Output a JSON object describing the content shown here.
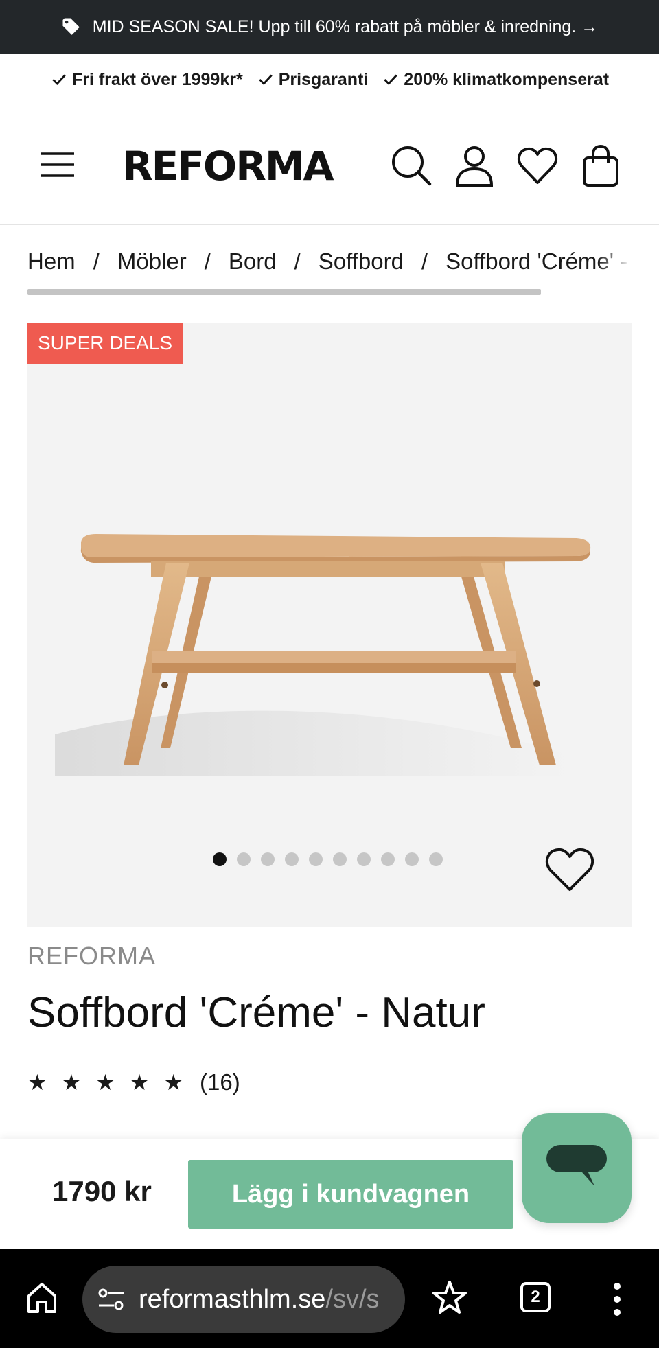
{
  "promo": {
    "text": "MID SEASON SALE! Upp till 60% rabatt på möbler & inredning. →",
    "icon": "tag-icon"
  },
  "usp": [
    {
      "label": "Fri frakt över 1999kr*"
    },
    {
      "label": "Prisgaranti"
    },
    {
      "label": "200% klimatkompenserat"
    }
  ],
  "header": {
    "logo": "REFORMA",
    "icons": [
      "menu-icon",
      "search-icon",
      "account-icon",
      "heart-icon",
      "shopping-bag-icon"
    ]
  },
  "breadcrumb": {
    "items": [
      "Hem",
      "Möbler",
      "Bord",
      "Soffbord",
      "Soffbord 'Créme' - Natur"
    ],
    "separator": "/"
  },
  "gallery": {
    "badge": "SUPER DEALS",
    "image_count": 10,
    "active_index": 0
  },
  "product": {
    "brand": "REFORMA",
    "title": "Soffbord 'Créme' - Natur",
    "stars": "★ ★ ★ ★ ★",
    "rating": 5,
    "review_count": "(16)"
  },
  "buybar": {
    "price": "1790 kr",
    "cart_label": "Lägg i kundvagnen"
  },
  "browser": {
    "url_host": "reformasthlm.se",
    "url_path": "/sv/s",
    "tab_count": "2"
  },
  "colors": {
    "promo_bg": "#23272a",
    "accent_green": "#72bb98",
    "badge_red": "#ef5b50"
  }
}
